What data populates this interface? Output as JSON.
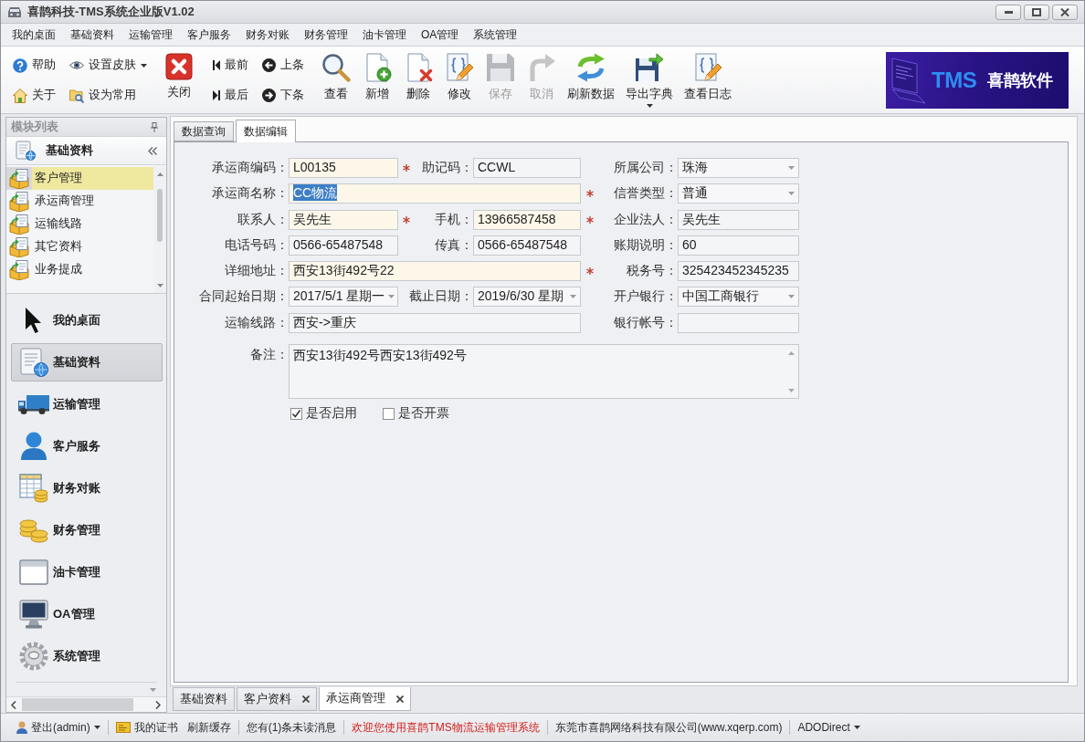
{
  "window": {
    "title": "喜鹊科技-TMS系统企业版V1.02"
  },
  "menu": [
    "我的桌面",
    "基础资料",
    "运输管理",
    "客户服务",
    "财务对账",
    "财务管理",
    "油卡管理",
    "OA管理",
    "系统管理"
  ],
  "toolbar": [
    {
      "kind": "stack",
      "buttons": [
        {
          "label": "帮助",
          "dropdown": false
        },
        {
          "label": "关于",
          "dropdown": false
        }
      ]
    },
    {
      "kind": "stack",
      "buttons": [
        {
          "label": "设置皮肤",
          "dropdown": true
        },
        {
          "label": "设为常用",
          "dropdown": false
        }
      ]
    },
    {
      "kind": "large",
      "label": "关闭",
      "disabled": false,
      "dropdown": false
    },
    {
      "kind": "stack",
      "buttons": [
        {
          "label": "最前",
          "dropdown": false
        },
        {
          "label": "最后",
          "dropdown": false
        }
      ]
    },
    {
      "kind": "stack",
      "buttons": [
        {
          "label": "上条",
          "dropdown": false
        },
        {
          "label": "下条",
          "dropdown": false
        }
      ]
    },
    {
      "kind": "large",
      "label": "查看",
      "disabled": false,
      "dropdown": false
    },
    {
      "kind": "large",
      "label": "新增",
      "disabled": false,
      "dropdown": false
    },
    {
      "kind": "large",
      "label": "删除",
      "disabled": false,
      "dropdown": false
    },
    {
      "kind": "large",
      "label": "修改",
      "disabled": false,
      "dropdown": false
    },
    {
      "kind": "large",
      "label": "保存",
      "disabled": true,
      "dropdown": false
    },
    {
      "kind": "large",
      "label": "取消",
      "disabled": true,
      "dropdown": false
    },
    {
      "kind": "large",
      "label": "刷新数据",
      "disabled": false,
      "dropdown": false
    },
    {
      "kind": "large",
      "label": "导出字典",
      "disabled": false,
      "dropdown": true
    },
    {
      "kind": "large",
      "label": "查看日志",
      "disabled": false,
      "dropdown": false
    }
  ],
  "logo": {
    "brand": "TMS",
    "name": "喜鹊软件"
  },
  "module_panel": {
    "title": "模块列表",
    "group": {
      "title": "基础资料",
      "items": [
        {
          "label": "客户管理",
          "selected": true
        },
        {
          "label": "承运商管理",
          "selected": false
        },
        {
          "label": "运输线路",
          "selected": false
        },
        {
          "label": "其它资料",
          "selected": false
        },
        {
          "label": "业务提成",
          "selected": false
        }
      ]
    },
    "nav": [
      {
        "label": "我的桌面",
        "selected": false
      },
      {
        "label": "基础资料",
        "selected": true
      },
      {
        "label": "运输管理",
        "selected": false
      },
      {
        "label": "客户服务",
        "selected": false
      },
      {
        "label": "财务对账",
        "selected": false
      },
      {
        "label": "财务管理",
        "selected": false
      },
      {
        "label": "油卡管理",
        "selected": false
      },
      {
        "label": "OA管理",
        "selected": false
      },
      {
        "label": "系统管理",
        "selected": false
      }
    ]
  },
  "tabs": [
    {
      "label": "数据查询",
      "selected": false
    },
    {
      "label": "数据编辑",
      "selected": true
    }
  ],
  "form": {
    "rows": [
      [
        {
          "label": "承运商编码：",
          "value": "L00135",
          "kind": "text",
          "required": true,
          "focused": false
        },
        {
          "label": "助记码：",
          "value": "CCWL",
          "kind": "text",
          "required": false,
          "focused": false
        },
        {
          "label": "所属公司：",
          "value": "珠海",
          "kind": "combo",
          "required": false,
          "focused": false
        }
      ],
      [
        {
          "label": "承运商名称：",
          "value": "CC物流",
          "kind": "text",
          "required": true,
          "focused": true
        },
        {
          "label": "信誉类型：",
          "value": "普通",
          "kind": "combo",
          "required": false,
          "focused": false
        }
      ],
      [
        {
          "label": "联系人：",
          "value": "吴先生",
          "kind": "text",
          "required": true,
          "focused": false
        },
        {
          "label": "手机：",
          "value": "13966587458",
          "kind": "text",
          "required": true,
          "focused": false
        },
        {
          "label": "企业法人：",
          "value": "吴先生",
          "kind": "text",
          "required": false,
          "focused": false
        }
      ],
      [
        {
          "label": "电话号码：",
          "value": "0566-65487548",
          "kind": "text",
          "required": false,
          "focused": false
        },
        {
          "label": "传真：",
          "value": "0566-65487548",
          "kind": "text",
          "required": false,
          "focused": false
        },
        {
          "label": "账期说明：",
          "value": "60",
          "kind": "text",
          "required": false,
          "focused": false
        }
      ],
      [
        {
          "label": "详细地址：",
          "value": "西安13街492号22",
          "kind": "text",
          "required": true,
          "focused": false
        },
        {
          "label": "税务号：",
          "value": "325423452345235",
          "kind": "text",
          "required": false,
          "focused": false
        }
      ],
      [
        {
          "label": "合同起始日期：",
          "value": "2017/5/1 星期一",
          "kind": "combo",
          "required": false,
          "focused": false
        },
        {
          "label": "截止日期：",
          "value": "2019/6/30 星期",
          "kind": "combo",
          "required": false,
          "focused": false
        },
        {
          "label": "开户银行：",
          "value": "中国工商银行",
          "kind": "combo",
          "required": false,
          "focused": false
        }
      ],
      [
        {
          "label": "运输线路：",
          "value": "西安->重庆",
          "kind": "text",
          "required": false,
          "focused": false
        },
        {
          "label": "银行帐号：",
          "kind": "text",
          "required": false
        }
      ],
      [
        {
          "label": "备注：",
          "value": "西安13街492号西安13街492号",
          "kind": "memo",
          "required": false,
          "focused": false
        }
      ]
    ],
    "checkboxes": [
      {
        "label": "是否启用",
        "checked": true
      },
      {
        "label": "是否开票",
        "checked": false
      }
    ]
  },
  "doc_tabs": [
    {
      "label": "基础资料",
      "selected": false,
      "closable": false
    },
    {
      "label": "客户资料",
      "selected": false,
      "closable": true
    },
    {
      "label": "承运商管理",
      "selected": true,
      "closable": true
    }
  ],
  "status_bar": [
    [
      {
        "label": "登出(admin)",
        "kind": "user",
        "dropdown": true
      }
    ],
    [
      {
        "label": "我的证书",
        "kind": "certificate",
        "dropdown": false
      },
      {
        "label": "刷新缓存",
        "kind": "link",
        "dropdown": false
      }
    ],
    [
      {
        "label": "您有(1)条未读消息",
        "kind": "link",
        "dropdown": false
      }
    ],
    [
      {
        "label": "欢迎您使用喜鹊TMS物流运输管理系统",
        "kind": "notice",
        "dropdown": false
      }
    ],
    [
      {
        "label": "东莞市喜鹊网络科技有限公司(www.xqerp.com)",
        "kind": "info",
        "dropdown": false
      }
    ],
    [
      {
        "label": "ADODirect",
        "kind": "link",
        "dropdown": true
      }
    ]
  ]
}
